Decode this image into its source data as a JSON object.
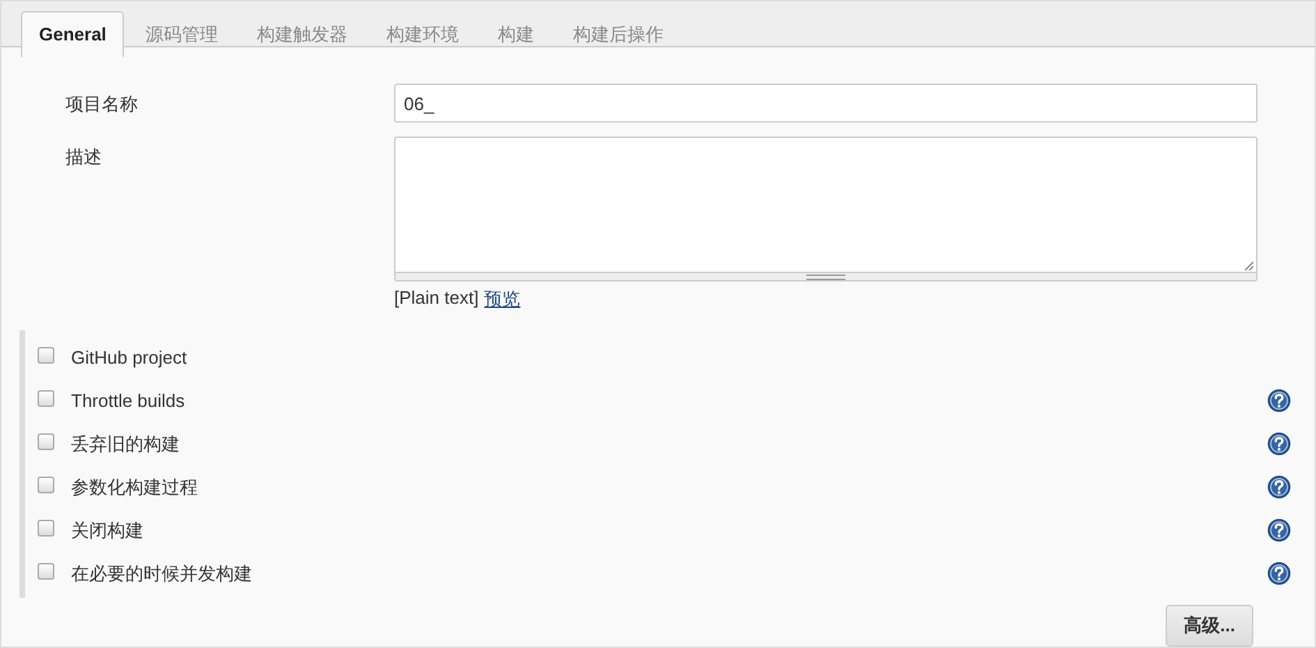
{
  "tabs": [
    {
      "label": "General",
      "selected": true
    },
    {
      "label": "源码管理",
      "selected": false
    },
    {
      "label": "构建触发器",
      "selected": false
    },
    {
      "label": "构建环境",
      "selected": false
    },
    {
      "label": "构建",
      "selected": false
    },
    {
      "label": "构建后操作",
      "selected": false
    }
  ],
  "form": {
    "name_label": "项目名称",
    "name_value": "06_",
    "description_label": "描述",
    "syntax": "[Plain text]",
    "preview_link": "预览"
  },
  "options": [
    {
      "label": "GitHub project",
      "checked": false,
      "help": false
    },
    {
      "label": "Throttle builds",
      "checked": false,
      "help": true
    },
    {
      "label": "丢弃旧的构建",
      "checked": false,
      "help": true
    },
    {
      "label": "参数化构建过程",
      "checked": false,
      "help": true
    },
    {
      "label": "关闭构建",
      "checked": false,
      "help": true
    },
    {
      "label": "在必要的时候并发构建",
      "checked": false,
      "help": true
    }
  ],
  "advanced_button": "高级..."
}
